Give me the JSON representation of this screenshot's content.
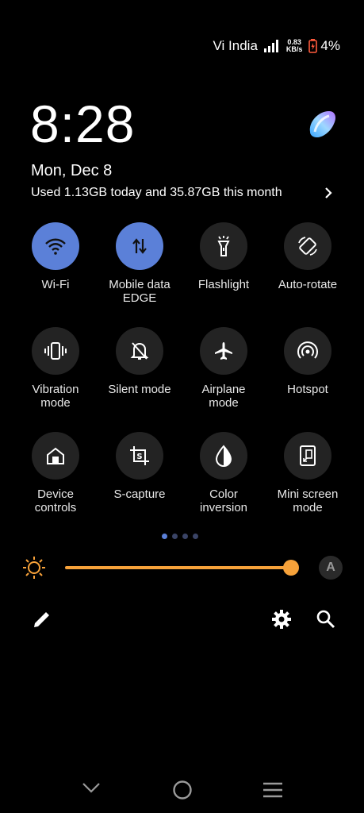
{
  "status": {
    "carrier": "Vi India",
    "speed_value": "0.83",
    "speed_unit": "KB/s",
    "battery": "4%"
  },
  "lockscreen": {
    "time": "8:28",
    "date": "Mon, Dec 8",
    "usage": "Used 1.13GB today and 35.87GB this month"
  },
  "tiles": [
    {
      "label": "Wi-Fi",
      "icon": "wifi-icon",
      "active": true
    },
    {
      "label": "Mobile data\nEDGE",
      "icon": "mobile-data-icon",
      "active": true
    },
    {
      "label": "Flashlight",
      "icon": "flashlight-icon",
      "active": false
    },
    {
      "label": "Auto-rotate",
      "icon": "auto-rotate-icon",
      "active": false
    },
    {
      "label": "Vibration\nmode",
      "icon": "vibration-icon",
      "active": false
    },
    {
      "label": "Silent mode",
      "icon": "silent-mode-icon",
      "active": false
    },
    {
      "label": "Airplane\nmode",
      "icon": "airplane-icon",
      "active": false
    },
    {
      "label": "Hotspot",
      "icon": "hotspot-icon",
      "active": false
    },
    {
      "label": "Device\ncontrols",
      "icon": "home-icon",
      "active": false
    },
    {
      "label": "S-capture",
      "icon": "s-capture-icon",
      "active": false
    },
    {
      "label": "Color\ninversion",
      "icon": "color-inversion-icon",
      "active": false
    },
    {
      "label": "Mini screen\nmode",
      "icon": "mini-screen-icon",
      "active": false
    }
  ],
  "pager": {
    "pages": 4,
    "current": 1
  },
  "brightness": {
    "level": 0.97,
    "auto_label": "A",
    "accent": "#f7a23a"
  },
  "colors": {
    "active_tile": "#5b80d8",
    "inactive_tile": "#232323"
  }
}
